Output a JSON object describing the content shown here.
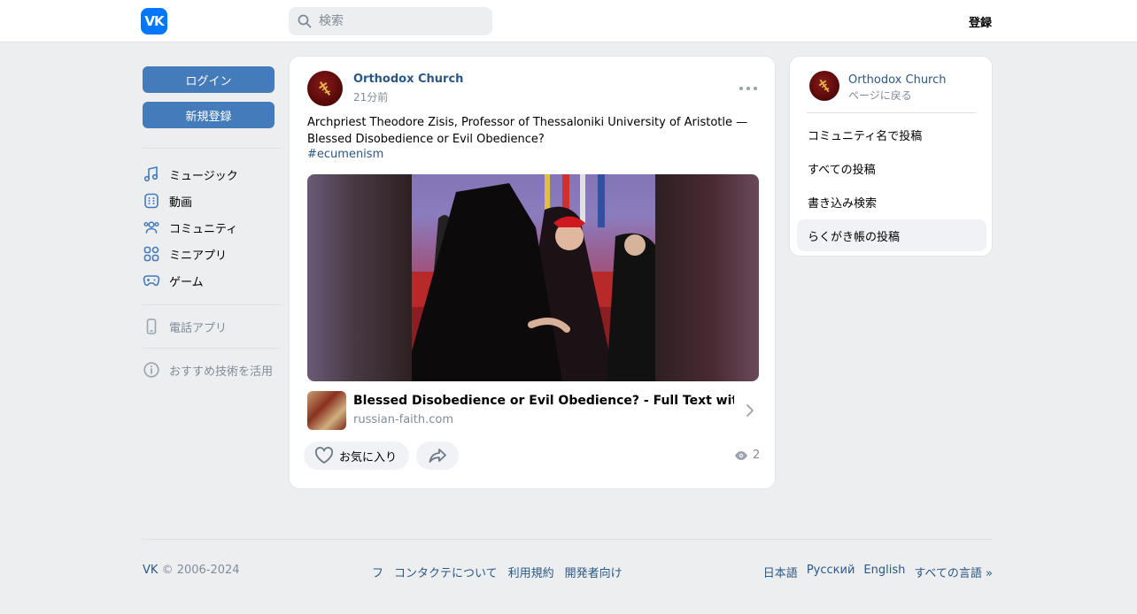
{
  "header": {
    "logo_text": "VK",
    "search_placeholder": "検索",
    "register_label": "登録"
  },
  "sidebar": {
    "login_label": "ログイン",
    "signup_label": "新規登録",
    "items": [
      {
        "label": "ミュージック",
        "icon": "music-icon"
      },
      {
        "label": "動画",
        "icon": "video-icon"
      },
      {
        "label": "コミュニティ",
        "icon": "community-icon"
      },
      {
        "label": "ミニアプリ",
        "icon": "mini-apps-icon"
      },
      {
        "label": "ゲーム",
        "icon": "gamepad-icon"
      }
    ],
    "phone_app_label": "電話アプリ",
    "recommend_label": "おすすめ技術を活用"
  },
  "post": {
    "author": "Orthodox Church",
    "time": "21分前",
    "text": "Archpriest Theodore Zisis, Professor of Thessaloniki University of Aristotle — Blessed Disobedience or Evil Obedience?",
    "hashtag": "#ecumenism",
    "link": {
      "title": "Blessed Disobedience or Evil Obedience? - Full Text with Footn...",
      "domain": "russian-faith.com"
    },
    "like_label": "お気に入り",
    "views": "2"
  },
  "right_panel": {
    "name": "Orthodox Church",
    "back_label": "ページに戻る",
    "items": [
      {
        "label": "コミュニティ名で投稿"
      },
      {
        "label": "すべての投稿"
      },
      {
        "label": "書き込み検索"
      },
      {
        "label": "らくがき帳の投稿",
        "active": true
      }
    ]
  },
  "footer": {
    "copyright_brand": "VK",
    "copyright_years": "© 2006-2024",
    "links": [
      "フ",
      "コンタクテについて",
      "利用規約",
      "開発者向け"
    ],
    "languages": [
      "日本語",
      "Русский",
      "English",
      "すべての言語 »"
    ]
  },
  "colors": {
    "accent": "#447bba",
    "link": "#2a5885",
    "brand": "#0077ff",
    "background": "#edeef0"
  }
}
